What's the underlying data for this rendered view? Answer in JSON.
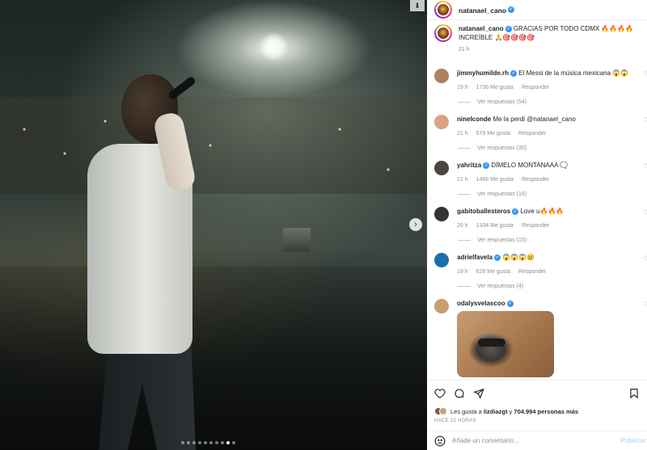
{
  "post": {
    "username": "natanael_cano",
    "caption_text": "GRACIAS POR TODO CDMX 🔥🔥🔥🔥 INCREÍBLE 🙏🎯🎯🎯🎯",
    "caption_time": "21 h",
    "photo_dots_count": 10,
    "photo_active_dot": 9
  },
  "comments": [
    {
      "username": "jimmyhumilde.rh",
      "text": "El Messi de la música mexicana 😱😱",
      "time": "19 h",
      "likes": "1736 Me gusta",
      "reply": "Responder",
      "replies": "Ver respuestas (54)",
      "avatar_color": "#b08060"
    },
    {
      "username": "ninelconde",
      "text": "Me la perdi @natanael_cano",
      "time": "21 h",
      "likes": "579 Me gusta",
      "reply": "Responder",
      "replies": "Ver respuestas (30)",
      "avatar_color": "#d9a384"
    },
    {
      "username": "yahritza",
      "text": "DÍMELO MONTANAAA 🗨️",
      "time": "21 h",
      "likes": "1468 Me gusta",
      "reply": "Responder",
      "replies": "Ver respuestas (18)",
      "avatar_color": "#4a4540"
    },
    {
      "username": "gabitoballesteros",
      "text": "Love u🔥🔥🔥",
      "time": "20 h",
      "likes": "1334 Me gusta",
      "reply": "Responder",
      "replies": "Ver respuestas (15)",
      "avatar_color": "#333333"
    },
    {
      "username": "adrielfavela",
      "text": "😱😱😱😢",
      "time": "19 h",
      "likes": "628 Me gusta",
      "reply": "Responder",
      "replies": "Ver respuestas (4)",
      "avatar_color": "#1a6fa8"
    },
    {
      "username": "odalysvelascoo",
      "text": "",
      "avatar_color": "#c7a070"
    }
  ],
  "likes": {
    "prefix": "Les gusta a",
    "first_user": "lizdiazgt",
    "connector": "y",
    "others": "704.994 personas más"
  },
  "post_time": "HACE 21 HORAS",
  "add_comment": {
    "placeholder": "Añade un comentario...",
    "post_label": "Publicar"
  },
  "colors": {
    "accent": "#3897f0",
    "muted": "#8e8e8e",
    "post_disabled": "#b2dffc"
  }
}
